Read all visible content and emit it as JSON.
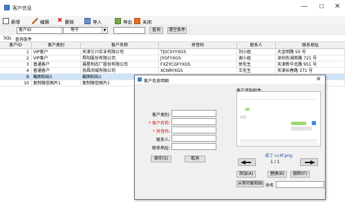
{
  "window": {
    "title": "客户信息"
  },
  "toolbar": {
    "new": "新增",
    "edit": "编辑",
    "delete": "删除",
    "import": "导入",
    "export": "导出",
    "close": "关闭"
  },
  "filter": {
    "field": "客户ID",
    "operator": "等于",
    "value": "",
    "query_label": "查询",
    "clear_label": "清空条件"
  },
  "sqlbar": {
    "sql": "SQL",
    "conditions": "查询条件"
  },
  "table": {
    "columns": [
      "客户ID",
      "客户类别",
      "客户名称",
      "拼音码",
      "联系人",
      "联系地址"
    ],
    "rows": [
      [
        "1",
        "VIP客户",
        "天津三川实业有限公司",
        "TJSCSYYXGS",
        "刘小姐",
        "大金明路 50 号"
      ],
      [
        "2",
        "VIP客户",
        "昇阳股份有限公司",
        "JYGFYXGS",
        "谢小姐",
        "深圳东湖南路 721 号"
      ],
      [
        "3",
        "普通客户",
        "福星制衣厂股份有限公司",
        "FXZYCGFYXGS",
        "徐先生",
        "天津新华北路 951 号"
      ],
      [
        "4",
        "普通客户",
        "协昌闭城有限公司",
        "XCNRYXGS",
        "王先生",
        "天津长春路 371 号"
      ],
      [
        "8",
        "截图粘贴1",
        "截图粘贴1",
        "",
        "",
        ""
      ],
      [
        "10",
        "复制微信图片1",
        "复制微信图片1",
        "",
        "",
        ""
      ]
    ]
  },
  "dialog": {
    "title": "客户信息明细",
    "labels": {
      "type": "客户类别:",
      "name": "客户名称:",
      "pinyin": "拼音码:",
      "contact": "联系人:",
      "address": "联系地址:"
    },
    "required_mark": "*",
    "save": "保存(S)",
    "cancel": "取消",
    "attachments_label": "客户资料附件:",
    "attachment_file": "成了-cc4f.png",
    "page": "1 / 1",
    "add": "添加(A)",
    "replace": "替换(B)",
    "remove": "删除(F)",
    "paste_from_clipboard": "从剪切板粘贴",
    "rename_label": "命名"
  },
  "colors": {
    "selected_row": "#cfe4f8",
    "required": "#d02020",
    "chat_green": "#9bdc74"
  }
}
